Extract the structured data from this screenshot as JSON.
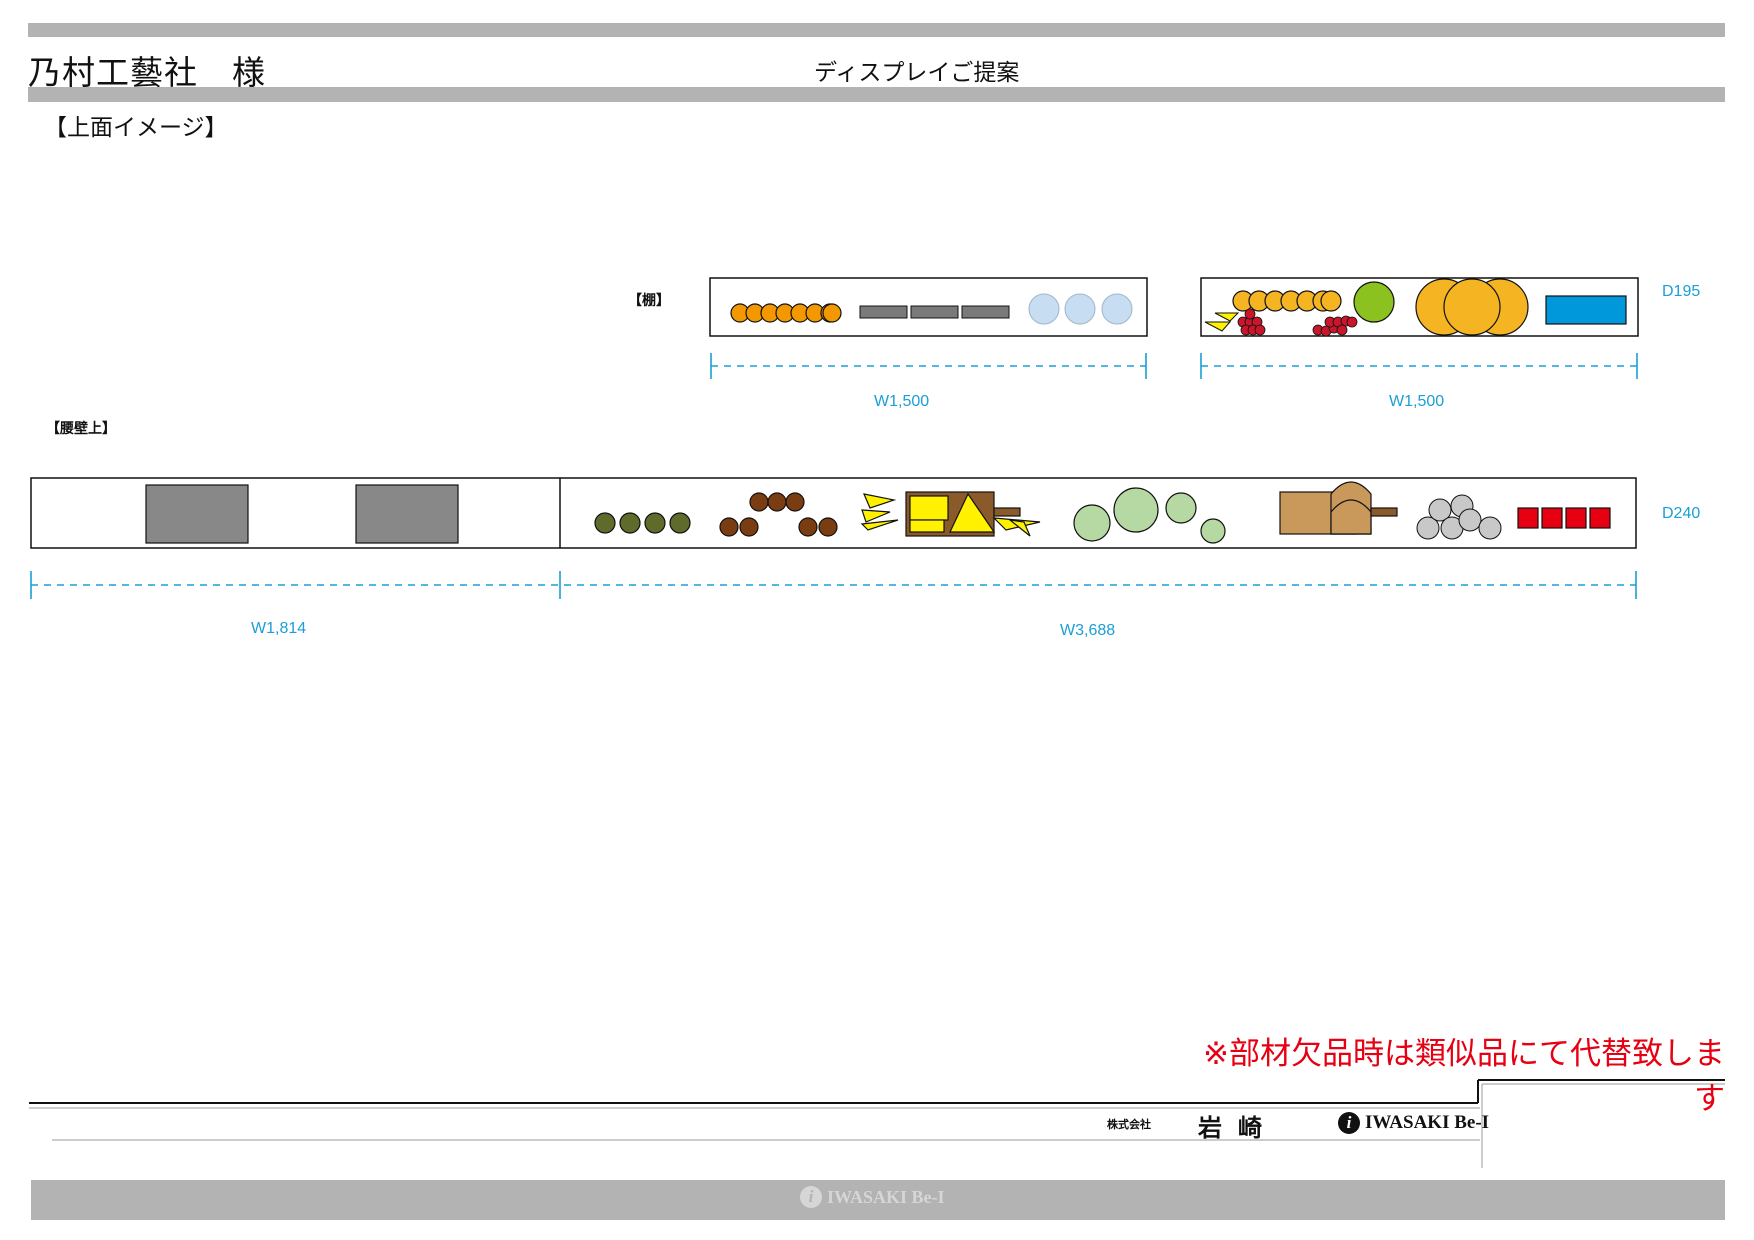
{
  "header": {
    "client_name": "乃村工藝社　様",
    "document_title": "ディスプレイご提案"
  },
  "section_title": "【上面イメージ】",
  "shelf": {
    "label": "【棚】",
    "depth": "D195",
    "widths": [
      "W1,500",
      "W1,500"
    ]
  },
  "wainscot": {
    "label": "【腰壁上】",
    "depth": "D240",
    "widths": [
      "W1,814",
      "W3,688"
    ]
  },
  "notice": "※部材欠品時は類似品にて代替致します",
  "company": {
    "prefix": "株式会社",
    "name": "岩崎",
    "brand": "IWASAKI Be-I",
    "footer_brand": "IWASAKI Be-I",
    "brand_icon": "i-logo-icon"
  },
  "colors": {
    "dimension": "#1a9fd6",
    "notice": "#e60012",
    "band": "#b3b3b3"
  }
}
